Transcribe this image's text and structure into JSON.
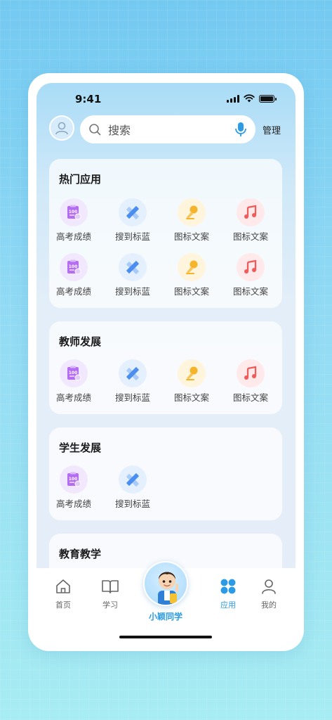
{
  "status": {
    "time": "9:41"
  },
  "header": {
    "search_placeholder": "搜索",
    "manage_label": "管理"
  },
  "sections": [
    {
      "title": "热门应用",
      "apps": [
        {
          "label": "高考成绩",
          "icon": "score-report-icon",
          "color": "#b36cf2"
        },
        {
          "label": "搜到标蓝",
          "icon": "pencil-ruler-icon",
          "color": "#4a8ef0"
        },
        {
          "label": "图标文案",
          "icon": "microphone-icon",
          "color": "#f5b42a"
        },
        {
          "label": "图标文案",
          "icon": "music-note-icon",
          "color": "#f25a5a"
        },
        {
          "label": "高考成绩",
          "icon": "score-report-icon",
          "color": "#b36cf2"
        },
        {
          "label": "搜到标蓝",
          "icon": "pencil-ruler-icon",
          "color": "#4a8ef0"
        },
        {
          "label": "图标文案",
          "icon": "microphone-icon",
          "color": "#f5b42a"
        },
        {
          "label": "图标文案",
          "icon": "music-note-icon",
          "color": "#f25a5a"
        }
      ]
    },
    {
      "title": "教师发展",
      "apps": [
        {
          "label": "高考成绩",
          "icon": "score-report-icon",
          "color": "#b36cf2"
        },
        {
          "label": "搜到标蓝",
          "icon": "pencil-ruler-icon",
          "color": "#4a8ef0"
        },
        {
          "label": "图标文案",
          "icon": "microphone-icon",
          "color": "#f5b42a"
        },
        {
          "label": "图标文案",
          "icon": "music-note-icon",
          "color": "#f25a5a"
        }
      ]
    },
    {
      "title": "学生发展",
      "apps": [
        {
          "label": "高考成绩",
          "icon": "score-report-icon",
          "color": "#b36cf2"
        },
        {
          "label": "搜到标蓝",
          "icon": "pencil-ruler-icon",
          "color": "#4a8ef0"
        }
      ]
    },
    {
      "title": "教育教学",
      "apps": []
    }
  ],
  "tabbar": {
    "items": [
      {
        "label": "首页",
        "icon": "home-icon"
      },
      {
        "label": "学习",
        "icon": "book-icon"
      },
      {
        "label": "小颖同学",
        "icon": "mascot-avatar"
      },
      {
        "label": "应用",
        "icon": "apps-grid-icon",
        "active": true
      },
      {
        "label": "我的",
        "icon": "user-icon"
      }
    ]
  },
  "colors": {
    "accent": "#2a9be4",
    "score_icon": "#b36cf2",
    "pencil_icon": "#4a8ef0",
    "mic_icon": "#f5b42a",
    "music_icon": "#f25a5a"
  }
}
